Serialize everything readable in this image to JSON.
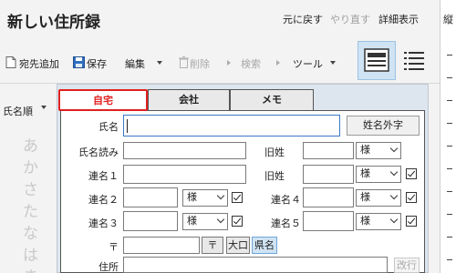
{
  "window": {
    "title": "新しい住所録",
    "menu": {
      "undo": "元に戻す",
      "redo": "やり直す",
      "detail_view": "詳細表示"
    },
    "right_strip_label": "縦"
  },
  "toolbar": {
    "add_recipient": "宛先追加",
    "save": "保存",
    "edit": "編集",
    "delete": "削除",
    "search": "検索",
    "tools": "ツール"
  },
  "left_panel": {
    "sort_label": "氏名順",
    "kana_index": [
      "あ",
      "か",
      "さ",
      "た",
      "な",
      "は",
      "ま"
    ]
  },
  "tabs": {
    "home": "自宅",
    "company": "会社",
    "memo": "メモ"
  },
  "form": {
    "name_label": "氏名",
    "name_value": "",
    "name_outside_button": "姓名外字",
    "reading_label": "氏名読み",
    "maiden_label_1": "旧姓",
    "maiden_label_2": "旧姓",
    "joint1_label": "連名１",
    "joint2_label": "連名２",
    "joint3_label": "連名３",
    "joint4_label": "連名４",
    "joint5_label": "連名５",
    "honorific": "様",
    "postal_label": "〒",
    "postal_button": "〒",
    "city_button": "大口",
    "pref_button": "県名",
    "address_label": "住所",
    "newline_button": "改行"
  },
  "colors": {
    "active_tab_border": "#e02020",
    "selected_view_bg": "#cfe3f3"
  }
}
